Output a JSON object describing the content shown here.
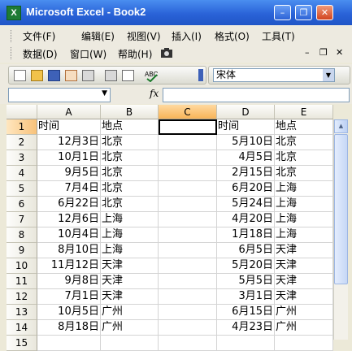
{
  "window": {
    "title": "Microsoft Excel - Book2",
    "app_icon": "X",
    "minimize_glyph": "–",
    "restore_glyph": "❐",
    "close_glyph": "✕"
  },
  "menu": {
    "row1": [
      "文件(F)",
      "编辑(E)",
      "视图(V)",
      "插入(I)",
      "格式(O)",
      "工具(T)"
    ],
    "row2": [
      "数据(D)",
      "窗口(W)",
      "帮助(H)"
    ],
    "doc_minimize": "–",
    "doc_restore": "❐",
    "doc_close": "✕"
  },
  "toolbar": {
    "icons": [
      "new-icon",
      "open-icon",
      "save-icon",
      "permission-icon",
      "print-icon",
      "print-icon-2",
      "print-preview-icon",
      "spelling-icon"
    ],
    "font_name": "宋体"
  },
  "formula_bar": {
    "name_box": "",
    "fx_label": "fx",
    "formula": ""
  },
  "sheet": {
    "columns": [
      "A",
      "B",
      "C",
      "D",
      "E"
    ],
    "selected_column": "C",
    "selected_row": "1",
    "rows": [
      {
        "n": "1",
        "a": "时间",
        "b": "地点",
        "c": "",
        "d": "时间",
        "e": "地点"
      },
      {
        "n": "2",
        "a": "12月3日",
        "b": "北京",
        "c": "",
        "d": "5月10日",
        "e": "北京"
      },
      {
        "n": "3",
        "a": "10月1日",
        "b": "北京",
        "c": "",
        "d": "4月5日",
        "e": "北京"
      },
      {
        "n": "4",
        "a": "9月5日",
        "b": "北京",
        "c": "",
        "d": "2月15日",
        "e": "北京"
      },
      {
        "n": "5",
        "a": "7月4日",
        "b": "北京",
        "c": "",
        "d": "6月20日",
        "e": "上海"
      },
      {
        "n": "6",
        "a": "6月22日",
        "b": "北京",
        "c": "",
        "d": "5月24日",
        "e": "上海"
      },
      {
        "n": "7",
        "a": "12月6日",
        "b": "上海",
        "c": "",
        "d": "4月20日",
        "e": "上海"
      },
      {
        "n": "8",
        "a": "10月4日",
        "b": "上海",
        "c": "",
        "d": "1月18日",
        "e": "上海"
      },
      {
        "n": "9",
        "a": "8月10日",
        "b": "上海",
        "c": "",
        "d": "6月5日",
        "e": "天津"
      },
      {
        "n": "10",
        "a": "11月12日",
        "b": "天津",
        "c": "",
        "d": "5月20日",
        "e": "天津"
      },
      {
        "n": "11",
        "a": "9月8日",
        "b": "天津",
        "c": "",
        "d": "5月5日",
        "e": "天津"
      },
      {
        "n": "12",
        "a": "7月1日",
        "b": "天津",
        "c": "",
        "d": "3月1日",
        "e": "天津"
      },
      {
        "n": "13",
        "a": "10月5日",
        "b": "广州",
        "c": "",
        "d": "6月15日",
        "e": "广州"
      },
      {
        "n": "14",
        "a": "8月18日",
        "b": "广州",
        "c": "",
        "d": "4月23日",
        "e": "广州"
      },
      {
        "n": "15",
        "a": "",
        "b": "",
        "c": "",
        "d": "",
        "e": ""
      }
    ]
  },
  "colors": {
    "title_bar": "#2a63d8",
    "selection": "#f8b458",
    "grid_line": "#d4d4d4"
  }
}
